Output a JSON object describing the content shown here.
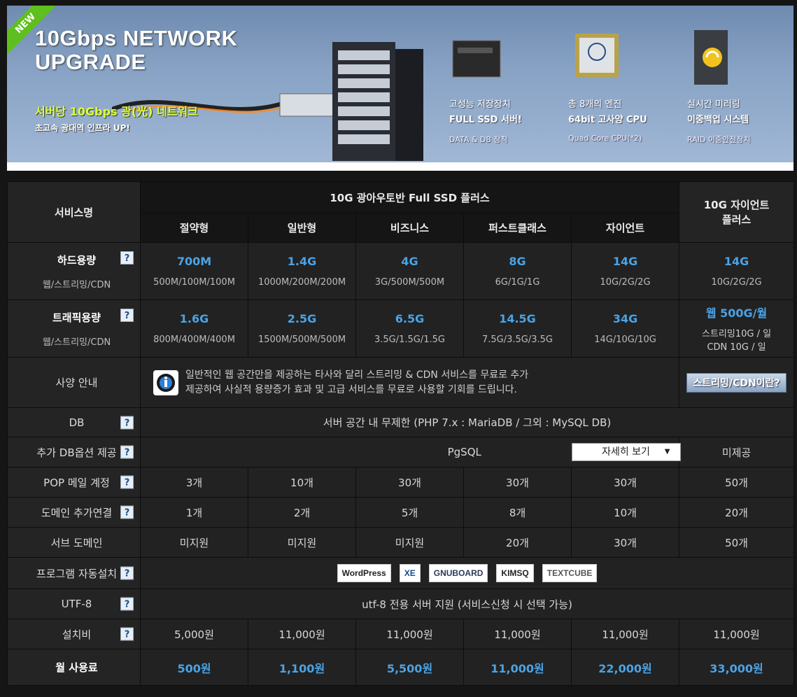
{
  "banner": {
    "badge": "NEW",
    "title_line1": "10Gbps NETWORK",
    "title_line2": "UPGRADE",
    "sub1": "서버당 10Gbps 광(光) 네트워크",
    "sub2": "초고속 광대역 인프라 UP!",
    "features": [
      {
        "l1": "고성능 저장장치",
        "l2": "FULL SSD 서버!",
        "l3": "DATA & DB 장착"
      },
      {
        "l1": "총 8개의 엔진",
        "l2": "64bit 고사양 CPU",
        "l3": "Quad Core CPU(*2)"
      },
      {
        "l1": "실시간 미러링",
        "l2": "이중백업 시스템",
        "l3": "RAID 이중안전장치"
      }
    ]
  },
  "table": {
    "service_header": "서비스명",
    "group_header": "10G 광아우토반 Full SSD 플러스",
    "giant_header_l1": "10G 자이언트",
    "giant_header_l2": "플러스",
    "plans": [
      "절약형",
      "일반형",
      "비즈니스",
      "퍼스트클래스",
      "자이언트"
    ],
    "help_icon": "?",
    "disk": {
      "label": "하드용량",
      "sub": "웹/스트리밍/CDN",
      "main": [
        "700M",
        "1.4G",
        "4G",
        "8G",
        "14G",
        "14G"
      ],
      "detail": [
        "500M/100M/100M",
        "1000M/200M/200M",
        "3G/500M/500M",
        "6G/1G/1G",
        "10G/2G/2G",
        "10G/2G/2G"
      ]
    },
    "traffic": {
      "label": "트래픽용량",
      "sub": "웹/스트리밍/CDN",
      "main": [
        "1.6G",
        "2.5G",
        "6.5G",
        "14.5G",
        "34G",
        "웹 500G/월"
      ],
      "detail": [
        "800M/400M/400M",
        "1500M/500M/500M",
        "3.5G/1.5G/1.5G",
        "7.5G/3.5G/3.5G",
        "14G/10G/10G"
      ],
      "giant_detail_l1": "스트리밍10G / 일",
      "giant_detail_l2": "CDN 10G / 일"
    },
    "spec": {
      "label": "사양 안내",
      "text_l1": "일반적인 웹 공간만을 제공하는 타사와 달리 스트리밍 & CDN 서비스를 무료로 추가",
      "text_l2": "제공하여 사실적 용량증가 효과 및 고급 서비스를 무료로 사용할 기회를 드립니다.",
      "button": "스트리밍/CDN이란?"
    },
    "db": {
      "label": "DB",
      "value": "서버 공간 내 무제한 (PHP 7.x : MariaDB / 그외 : MySQL DB)"
    },
    "extra_db": {
      "label": "추가 DB옵션 제공",
      "value": "PgSQL",
      "detail_button": "자세히 보기",
      "giant": "미제공"
    },
    "pop": {
      "label": "POP 메일 계정",
      "values": [
        "3개",
        "10개",
        "30개",
        "30개",
        "30개",
        "50개"
      ]
    },
    "domain": {
      "label": "도메인 추가연결",
      "values": [
        "1개",
        "2개",
        "5개",
        "8개",
        "10개",
        "20개"
      ]
    },
    "subdomain": {
      "label": "서브 도메인",
      "values": [
        "미지원",
        "미지원",
        "미지원",
        "20개",
        "30개",
        "50개"
      ]
    },
    "autoinstall": {
      "label": "프로그램 자동설치",
      "logos": [
        "WordPress",
        "XE",
        "GNUBOARD",
        "KIMSQ",
        "TEXTCUBE"
      ]
    },
    "utf8": {
      "label": "UTF-8",
      "value": "utf-8 전용 서버 지원 (서비스신청 시 선택 가능)"
    },
    "setup": {
      "label": "설치비",
      "values": [
        "5,000원",
        "11,000원",
        "11,000원",
        "11,000원",
        "11,000원",
        "11,000원"
      ]
    },
    "monthly": {
      "label": "월 사용료",
      "values": [
        "500원",
        "1,100원",
        "5,500원",
        "11,000원",
        "22,000원",
        "33,000원"
      ]
    }
  }
}
